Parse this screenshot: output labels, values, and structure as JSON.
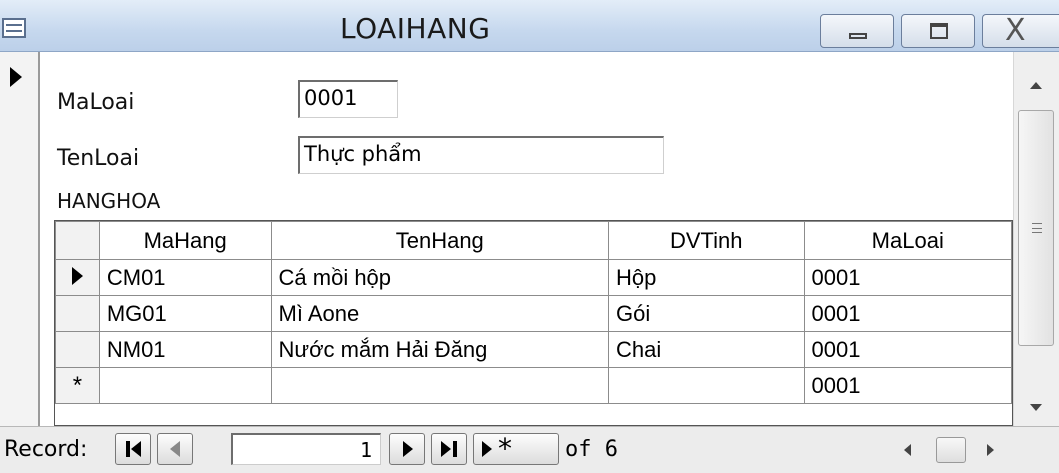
{
  "window": {
    "title": "LOAIHANG",
    "controls": [
      "minimize",
      "maximize",
      "close"
    ],
    "close_glyph": "X"
  },
  "form": {
    "fields": [
      {
        "label": "MaLoai",
        "value": "0001"
      },
      {
        "label": "TenLoai",
        "value": "Thực phẩm"
      }
    ],
    "subform_label": "HANGHOA"
  },
  "subform": {
    "columns": [
      "MaHang",
      "TenHang",
      "DVTinh",
      "MaLoai"
    ],
    "rows": [
      [
        "CM01",
        "Cá mồi hộp",
        "Hộp",
        "0001"
      ],
      [
        "MG01",
        "Mì Aone",
        "Gói",
        "0001"
      ],
      [
        "NM01",
        "Nước mắm Hải Đăng",
        "Chai",
        "0001"
      ]
    ],
    "new_row_marker": "*",
    "new_row": [
      "",
      "",
      "",
      "0001"
    ]
  },
  "navigation": {
    "label": "Record:",
    "current": "1",
    "of_text": "of 6"
  },
  "icons": {
    "system": "form-icon",
    "record_selector": "current-record-arrow-icon"
  }
}
